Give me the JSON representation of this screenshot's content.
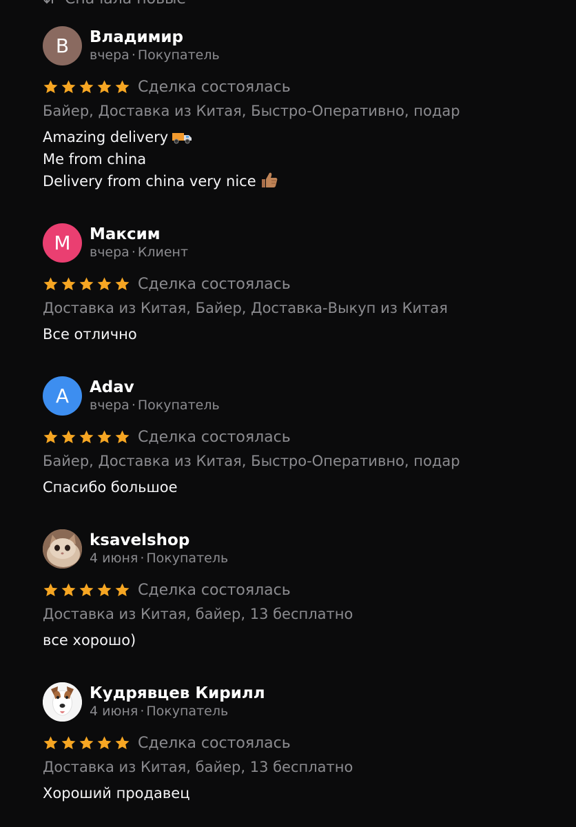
{
  "sort": {
    "label": "Сначала новые",
    "icon": "sort-arrows-icon"
  },
  "star_color": "#f6a623",
  "reviews": [
    {
      "author": "Владимир",
      "initial": "В",
      "avatar_color": "#8a6a60",
      "date": "вчера",
      "role": "Покупатель",
      "rating": 5,
      "status": "Сделка состоялась",
      "tags": "Байер, Доставка из Китая, Быстро-Оперативно, подар",
      "text_lines": [
        "Amazing delivery",
        "Me from china",
        "Delivery from china very nice"
      ],
      "emoji": [
        "truck-icon",
        "thumbs-up-icon"
      ]
    },
    {
      "author": "Максим",
      "initial": "М",
      "avatar_color": "#ea3f71",
      "date": "вчера",
      "role": "Клиент",
      "rating": 5,
      "status": "Сделка состоялась",
      "tags": "Доставка из Китая, Байер, Доставка-Выкуп из Китая",
      "text_lines": [
        "Все отлично"
      ]
    },
    {
      "author": "Adav",
      "initial": "A",
      "avatar_color": "#3d8ef0",
      "date": "вчера",
      "role": "Покупатель",
      "rating": 5,
      "status": "Сделка состоялась",
      "tags": "Байер, Доставка из Китая, Быстро-Оперативно, подар",
      "text_lines": [
        "Спасибо большое"
      ]
    },
    {
      "author": "ksavelshop",
      "avatar_image": "cat-photo-avatar",
      "date": "4 июня",
      "role": "Покупатель",
      "rating": 5,
      "status": "Сделка состоялась",
      "tags": "Доставка из Китая, байер, 13 бесплатно",
      "text_lines": [
        "все хорошо)"
      ]
    },
    {
      "author": "Кудрявцев Кирилл",
      "avatar_image": "dog-photo-avatar",
      "date": "4 июня",
      "role": "Покупатель",
      "rating": 5,
      "status": "Сделка состоялась",
      "tags": "Доставка из Китая, байер, 13 бесплатно",
      "text_lines": [
        "Хороший продавец"
      ]
    }
  ]
}
